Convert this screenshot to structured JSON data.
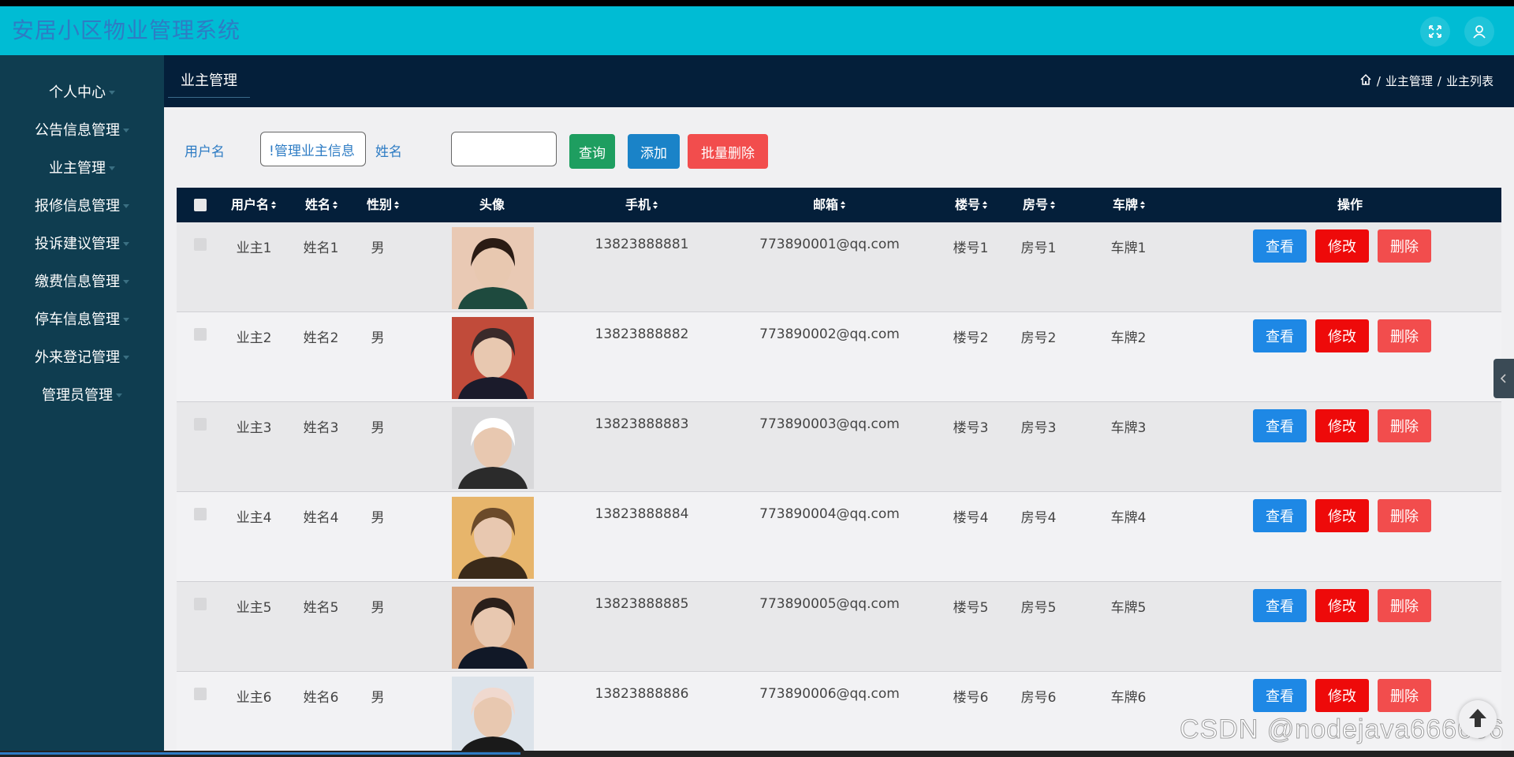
{
  "app": {
    "title": "安居小区物业管理系统"
  },
  "topbar": {
    "icons": [
      "fullscreen-icon",
      "user-icon"
    ]
  },
  "sidebar": {
    "items": [
      {
        "label": "个人中心"
      },
      {
        "label": "公告信息管理"
      },
      {
        "label": "业主管理"
      },
      {
        "label": "报修信息管理"
      },
      {
        "label": "投诉建议管理"
      },
      {
        "label": "缴费信息管理"
      },
      {
        "label": "停车信息管理"
      },
      {
        "label": "外来登记管理"
      },
      {
        "label": "管理员管理"
      }
    ]
  },
  "header": {
    "tab": "业主管理",
    "breadcrumb": [
      "/",
      "业主管理",
      "/",
      "业主列表"
    ]
  },
  "search": {
    "username_label": "用户名",
    "username_value": "!管理业主信息",
    "name_label": "姓名",
    "name_value": "",
    "query_button": "查询",
    "add_button": "添加",
    "batch_delete_button": "批量删除"
  },
  "colors": {
    "topbar": "#00BCD4",
    "sidebar": "#0F3D50",
    "header": "#041F3A",
    "query": "#1E9E60",
    "add": "#1A83C8",
    "batch_delete": "#F24D4D",
    "view": "#1E88E5",
    "edit": "#EE0A0A",
    "delete": "#F24D4D"
  },
  "table": {
    "columns": [
      "用户名",
      "姓名",
      "性别",
      "头像",
      "手机",
      "邮箱",
      "楼号",
      "房号",
      "车牌",
      "操作"
    ],
    "rows": [
      {
        "username": "业主1",
        "name": "姓名1",
        "gender": "男",
        "phone": "13823888881",
        "email": "773890001@qq.com",
        "building": "楼号1",
        "room": "房号1",
        "plate": "车牌1"
      },
      {
        "username": "业主2",
        "name": "姓名2",
        "gender": "男",
        "phone": "13823888882",
        "email": "773890002@qq.com",
        "building": "楼号2",
        "room": "房号2",
        "plate": "车牌2"
      },
      {
        "username": "业主3",
        "name": "姓名3",
        "gender": "男",
        "phone": "13823888883",
        "email": "773890003@qq.com",
        "building": "楼号3",
        "room": "房号3",
        "plate": "车牌3"
      },
      {
        "username": "业主4",
        "name": "姓名4",
        "gender": "男",
        "phone": "13823888884",
        "email": "773890004@qq.com",
        "building": "楼号4",
        "room": "房号4",
        "plate": "车牌4"
      },
      {
        "username": "业主5",
        "name": "姓名5",
        "gender": "男",
        "phone": "13823888885",
        "email": "773890005@qq.com",
        "building": "楼号5",
        "room": "房号5",
        "plate": "车牌5"
      },
      {
        "username": "业主6",
        "name": "姓名6",
        "gender": "男",
        "phone": "13823888886",
        "email": "773890006@qq.com",
        "building": "楼号6",
        "room": "房号6",
        "plate": "车牌6"
      }
    ],
    "actions": {
      "view": "查看",
      "edit": "修改",
      "delete": "删除"
    }
  },
  "watermark": "CSDN @nodejava666666"
}
